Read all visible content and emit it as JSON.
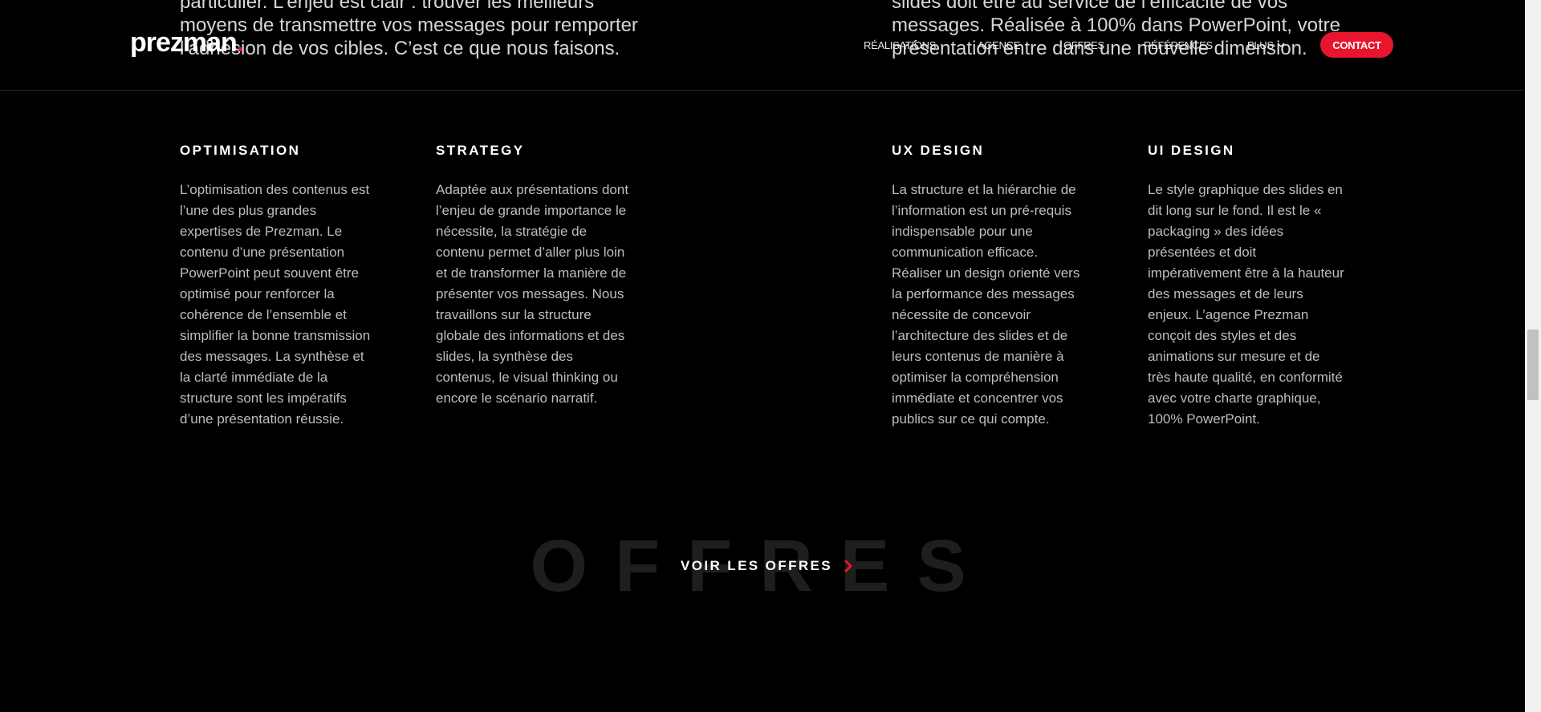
{
  "intro": {
    "left_lines": [
      "particulier. L’enjeu est clair : trouver les meilleurs",
      "moyens de transmettre vos messages pour remporter",
      "l’adhésion de vos cibles. C’est ce que nous faisons."
    ],
    "right_lines": [
      "slides doit être au service de l’efficacité de vos",
      "messages. Réalisée à 100% dans PowerPoint, votre",
      "présentation entre dans une nouvelle dimension."
    ]
  },
  "header": {
    "logo": "prezman",
    "logo_dot": ".",
    "nav": {
      "realisations": "Réalisations",
      "agence": "Agence",
      "offres": "Offres",
      "references": "Références",
      "plus": "Plus"
    },
    "contact": "Contact"
  },
  "services": [
    {
      "title": "Optimisation",
      "text": "L’optimisation des contenus est l’une des plus grandes expertises de Prezman. Le contenu d’une présentation PowerPoint peut souvent être optimisé pour renforcer la cohérence de l’ensemble et simplifier la bonne transmission des messages. La synthèse et la clarté immédiate de la structure sont les impératifs d’une présentation réussie."
    },
    {
      "title": "Strategy",
      "text": "Adaptée aux présentations dont l’enjeu de grande importance le nécessite, la stratégie de contenu permet d’aller plus loin et de transformer la manière de présenter vos messages. Nous travaillons sur la structure globale des informations et des slides, la synthèse des contenus, le visual thinking ou encore le scénario narratif."
    },
    {
      "title": "UX Design",
      "text": "La structure et la hiérarchie de l’information est un pré-requis indispensable pour une communication efficace. Réaliser un design orienté vers la performance des messages nécessite de concevoir l’architecture des slides et de leurs contenus de manière à optimiser la compréhension immédiate et concentrer vos publics sur ce qui compte."
    },
    {
      "title": "UI Design",
      "text": "Le style graphique des slides en dit long sur le fond. Il est le « packaging » des idées présentées et doit impérativement être à la hauteur des messages et de leurs enjeux. L’agence Prezman conçoit des styles et des animations sur mesure et de très haute qualité, en conformité avec votre charte graphique, 100% PowerPoint."
    }
  ],
  "offres": {
    "background_word": "Offres",
    "cta": "Voir les offres"
  },
  "colors": {
    "accent": "#e8152f",
    "background": "#000000",
    "muted_text": "#bdbdbd"
  }
}
